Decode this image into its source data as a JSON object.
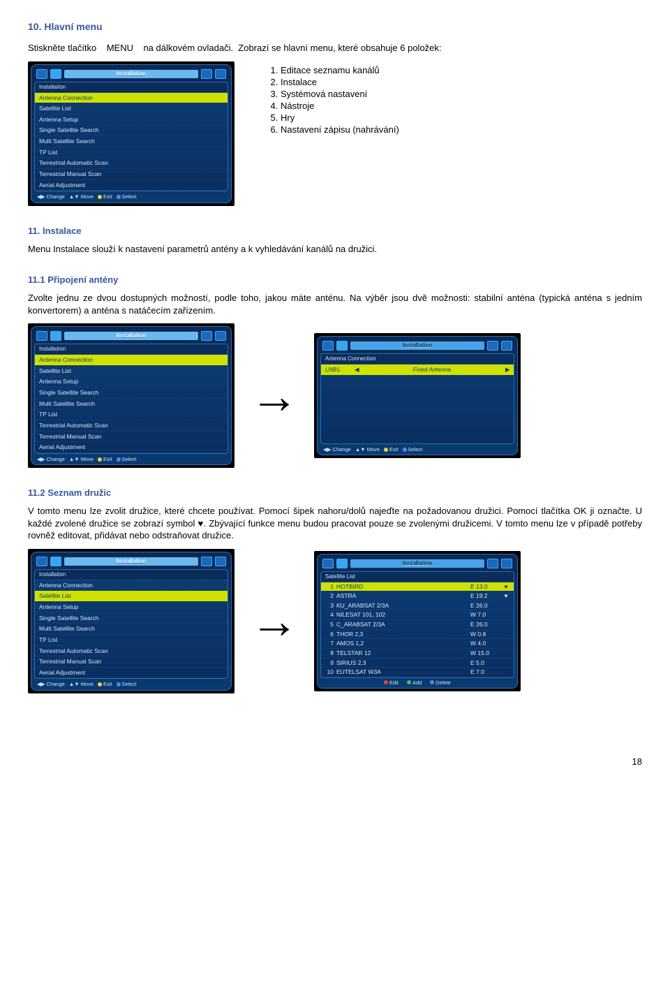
{
  "sections": {
    "s10": {
      "title": "10. Hlavní menu",
      "intro": "Stiskněte tlačítko    MENU    na dálkovém ovladači.  Zobrazí se hlavní menu, které obsahuje 6 položek:",
      "list": [
        "Editace seznamu kanálů",
        "Instalace",
        "Systémová nastavení",
        "Nástroje",
        "Hry",
        "Nastavení zápisu (nahrávání)"
      ]
    },
    "s11": {
      "title": "11. Instalace",
      "body": "Menu Instalace slouží k nastavení parametrů antény a k vyhledávání kanálů na družici."
    },
    "s11_1": {
      "title": "11.1 Připojení antény",
      "body": "Zvolte jednu ze dvou dostupných možností, podle toho, jakou máte anténu. Na výběr jsou dvě možnosti: stabilní anténa (typická anténa s jedním konvertorem) a anténa s natáčecím zařízením."
    },
    "s11_2": {
      "title": "11.2 Seznam družic",
      "body": "V tomto menu lze zvolit družice, které chcete používat. Pomocí šipek nahoru/dolů najeďte na požadovanou družici. Pomocí tlačítka OK ji označte. U každé zvolené družice se zobrazí symbol ♥. Zbývající funkce menu budou pracovat pouze se zvolenými družicemi. V tomto menu lze v případě potřeby rovněž editovat, přidávat nebo odstraňovat družice."
    }
  },
  "menu": {
    "top_title": "Installation",
    "header": "Installation",
    "items": [
      "Antenna Connection",
      "Satellite List",
      "Antenna Setup",
      "Single Satellite Search",
      "Multi Satellite Search",
      "TP List",
      "Terrestrial Automatic Scan",
      "Terrestrial Manual Scan",
      "Aerial Adjustment"
    ],
    "bottom": {
      "change": "Change",
      "move": "Move",
      "exit": "Exit",
      "select": "Select"
    },
    "bottom2": {
      "edit": "Edit",
      "add": "Add",
      "del": "Delete"
    }
  },
  "antenna_menu": {
    "header": "Antenna Connection",
    "lnb": "LNB1",
    "value": "Fixed Antenna"
  },
  "sat_menu": {
    "header": "Satellite List",
    "rows": [
      {
        "n": "1",
        "name": "HOTBIRD",
        "pos": "E 13.0",
        "mark": "♥"
      },
      {
        "n": "2",
        "name": "ASTRA",
        "pos": "E 19.2",
        "mark": "♥"
      },
      {
        "n": "3",
        "name": "KU_ARABSAT 2/3A",
        "pos": "E 26.0",
        "mark": ""
      },
      {
        "n": "4",
        "name": "NILESAT 101, 102",
        "pos": "W 7.0",
        "mark": ""
      },
      {
        "n": "5",
        "name": "C_ARABSAT 2/3A",
        "pos": "E 26.0",
        "mark": ""
      },
      {
        "n": "6",
        "name": "THOR 2,3",
        "pos": "W 0.8",
        "mark": ""
      },
      {
        "n": "7",
        "name": "AMOS 1,2",
        "pos": "W 4.0",
        "mark": ""
      },
      {
        "n": "8",
        "name": "TELSTAR 12",
        "pos": "W 15.0",
        "mark": ""
      },
      {
        "n": "9",
        "name": "SIRIUS 2,3",
        "pos": "E 5.0",
        "mark": ""
      },
      {
        "n": "10",
        "name": "EUTELSAT W3A",
        "pos": "E 7.0",
        "mark": ""
      }
    ]
  },
  "page_number": "18",
  "arrow_glyph": "→"
}
